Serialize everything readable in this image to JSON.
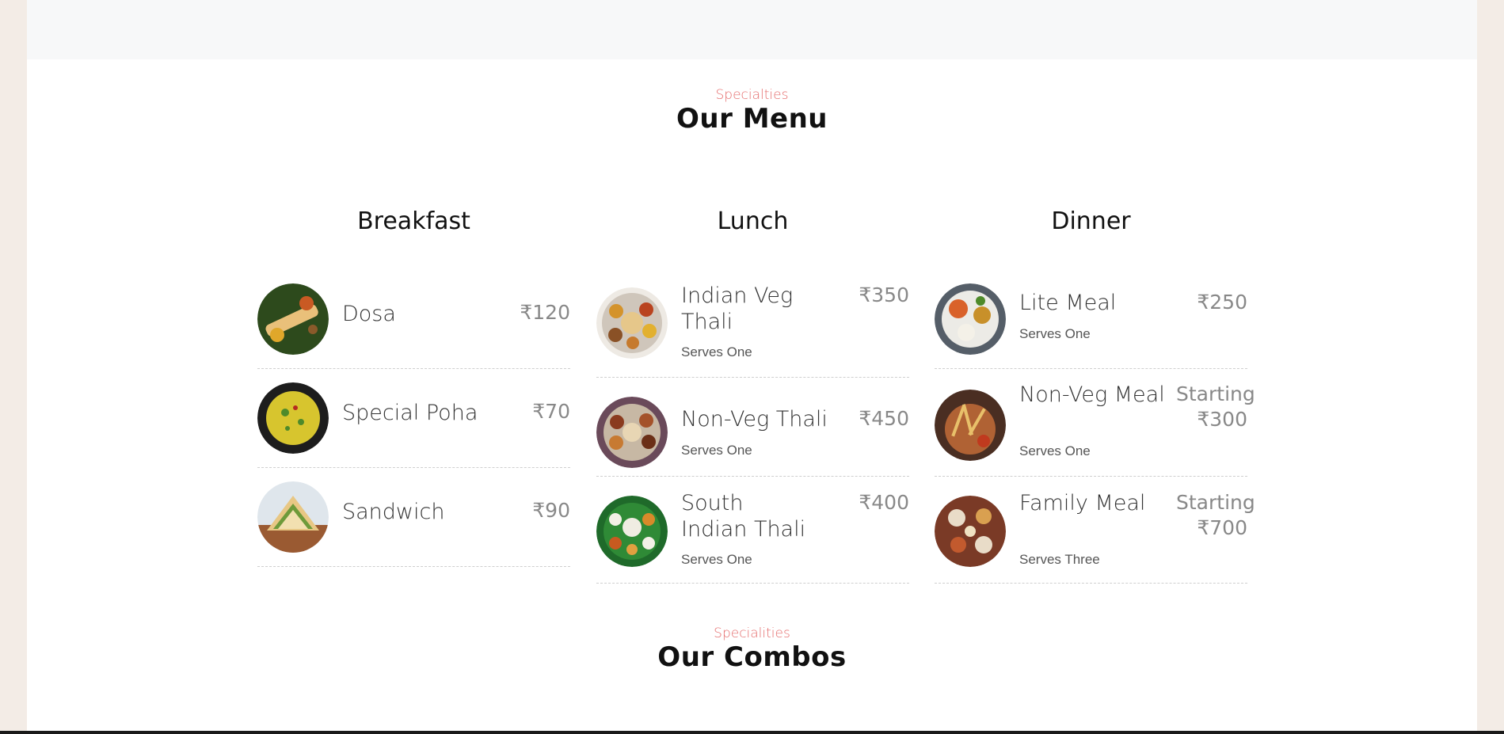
{
  "menu_section": {
    "eyebrow": "Specialties",
    "title": "Our Menu"
  },
  "columns": [
    {
      "title": "Breakfast",
      "items": [
        {
          "name": "Dosa",
          "price": "₹120",
          "serves": "",
          "image": "dosa-image"
        },
        {
          "name": "Special Poha",
          "price": "₹70",
          "serves": "",
          "image": "poha-image"
        },
        {
          "name": "Sandwich",
          "price": "₹90",
          "serves": "",
          "image": "sandwich-image"
        }
      ]
    },
    {
      "title": "Lunch",
      "items": [
        {
          "name": "Indian Veg Thali",
          "price": "₹350",
          "serves": "Serves One",
          "image": "veg-thali-image"
        },
        {
          "name": "Non-Veg Thali",
          "price": "₹450",
          "serves": "Serves One",
          "image": "non-veg-thali-image"
        },
        {
          "name": "South Indian Thali",
          "price": "₹400",
          "serves": "Serves One",
          "image": "south-indian-thali-image"
        }
      ]
    },
    {
      "title": "Dinner",
      "items": [
        {
          "name": "Lite Meal",
          "price": "₹250",
          "serves": "Serves One",
          "image": "lite-meal-image"
        },
        {
          "name": "Non-Veg Meal",
          "price": "Starting ₹300",
          "serves": "Serves One",
          "image": "non-veg-meal-image"
        },
        {
          "name": "Family Meal",
          "price": "Starting ₹700",
          "serves": "Serves Three",
          "image": "family-meal-image"
        }
      ]
    }
  ],
  "combos_section": {
    "eyebrow": "Specialities",
    "title": "Our Combos"
  },
  "colors": {
    "accent": "#e56c6c",
    "page_bg": "#f3ece6",
    "card_bg": "#ffffff"
  }
}
